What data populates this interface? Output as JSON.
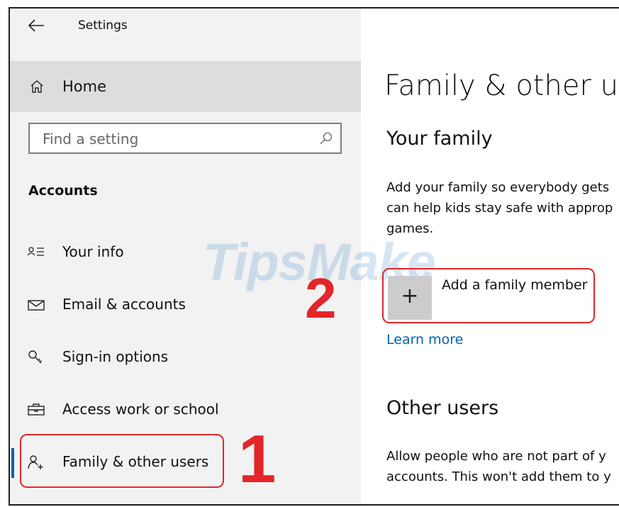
{
  "window": {
    "title": "Settings",
    "back_icon": "back-arrow-icon"
  },
  "sidebar": {
    "home_label": "Home",
    "search_placeholder": "Find a setting",
    "section_heading": "Accounts",
    "items": [
      {
        "label": "Your info",
        "icon": "person-lines-icon"
      },
      {
        "label": "Email & accounts",
        "icon": "envelope-icon"
      },
      {
        "label": "Sign-in options",
        "icon": "key-icon"
      },
      {
        "label": "Access work or school",
        "icon": "briefcase-icon"
      },
      {
        "label": "Family & other users",
        "icon": "person-add-icon",
        "selected": true
      }
    ]
  },
  "main": {
    "title": "Family & other use",
    "your_family": {
      "heading": "Your family",
      "description": [
        "Add your family so everybody gets",
        "can help kids stay safe with approp",
        "games."
      ],
      "add_label": "Add a family member",
      "learn_more": "Learn more"
    },
    "other_users": {
      "heading": "Other users",
      "description": [
        "Allow people who are not part of y",
        "accounts. This won't add them to y"
      ]
    }
  },
  "annotations": {
    "step1": "1",
    "step2": "2"
  },
  "watermark": {
    "text": "TipsMake",
    "sub": ".com"
  },
  "colors": {
    "accent": "#0063b1",
    "annotation": "#e3262a",
    "sidebar_bg": "#f2f2f2",
    "home_bg": "#dddddd"
  }
}
